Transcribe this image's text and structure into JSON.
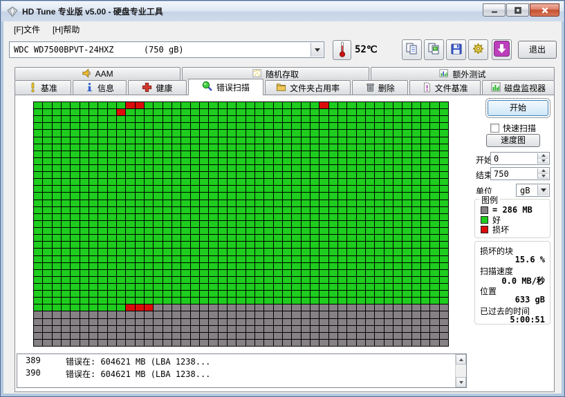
{
  "window": {
    "title": "HD Tune 专业版 v5.00 - 硬盘专业工具"
  },
  "menu": {
    "items": [
      {
        "label": "[F]文件"
      },
      {
        "label": "[H]帮助"
      }
    ]
  },
  "toolbar": {
    "drive_selector_value": "WDC WD7500BPVT-24HXZ      (750 gB)",
    "temperature": "52℃",
    "buttons": [
      {
        "icon": "copy-text-icon"
      },
      {
        "icon": "copy-image-icon"
      },
      {
        "icon": "save-icon"
      },
      {
        "icon": "options-icon"
      },
      {
        "icon": "update-icon"
      }
    ],
    "exit_label": "退出"
  },
  "tabs": {
    "row1": [
      {
        "label": "AAM",
        "icon": "speaker-icon",
        "active": false
      },
      {
        "label": "随机存取",
        "icon": "random-access-icon",
        "active": false
      },
      {
        "label": "额外测试",
        "icon": "extra-tests-icon",
        "active": false
      }
    ],
    "row2": [
      {
        "label": "基准",
        "icon": "benchmark-icon",
        "active": false
      },
      {
        "label": "信息",
        "icon": "info-icon",
        "active": false
      },
      {
        "label": "健康",
        "icon": "health-icon",
        "active": false
      },
      {
        "label": "错误扫描",
        "icon": "error-scan-icon",
        "active": true
      },
      {
        "label": "文件夹占用率",
        "icon": "folder-usage-icon",
        "active": false
      },
      {
        "label": "删除",
        "icon": "erase-icon",
        "active": false
      },
      {
        "label": "文件基准",
        "icon": "file-benchmark-icon",
        "active": false
      },
      {
        "label": "磁盘监视器",
        "icon": "disk-monitor-icon",
        "active": false
      }
    ]
  },
  "scan_controls": {
    "start_button": "开始",
    "quick_scan_label": "快速扫描",
    "quick_scan_checked": false,
    "speed_map_button": "速度图",
    "start_label": "开始",
    "start_value": "0",
    "end_label": "结束",
    "end_value": "750",
    "unit_label": "单位",
    "unit_value": "gB"
  },
  "legend": {
    "title": "图例",
    "entries": [
      {
        "swatch": "gray",
        "label": "= 286 MB"
      },
      {
        "swatch": "green",
        "label": "好"
      },
      {
        "swatch": "red",
        "label": "损坏"
      }
    ]
  },
  "stats": [
    {
      "label": "损坏的块",
      "value": "15.6 %"
    },
    {
      "label": "扫描速度",
      "value": "0.0 MB/秒"
    },
    {
      "label": "位置",
      "value": "633 gB"
    },
    {
      "label": "已过去的时间",
      "value": "5:00:51"
    }
  ],
  "errors": [
    {
      "num": "389",
      "message": "错误在: 604621 MB (LBA 1238..."
    },
    {
      "num": "390",
      "message": "错误在: 604621 MB (LBA 1238..."
    }
  ],
  "chart_data": {
    "type": "heatmap",
    "title": "disk surface error-scan block map",
    "columns": 45,
    "rows": 35,
    "block_size_label": "= 286 MB",
    "legend": {
      "G": "好 (good)",
      "B": "损坏 (damaged)",
      "U": "unscanned"
    },
    "cell_colors": {
      "G": "#1ecd1e",
      "B": "#dd0c0c",
      "U": "#858185"
    },
    "block_rows_rle": [
      "10G 2B 19G 1B 13G",
      "9G 1B 35G",
      "45G",
      "45G",
      "45G",
      "45G",
      "45G",
      "45G",
      "45G",
      "45G",
      "45G",
      "45G",
      "45G",
      "45G",
      "45G",
      "45G",
      "45G",
      "45G",
      "45G",
      "45G",
      "45G",
      "45G",
      "45G",
      "45G",
      "45G",
      "45G",
      "45G",
      "45G",
      "45G",
      "10G 3B 32U",
      "45U",
      "45U",
      "45U",
      "45U",
      "45U"
    ]
  },
  "colors": {
    "good_green": "#1ecd1e",
    "bad_red": "#dd0c0c",
    "unscanned_gray": "#858185",
    "update_purple": "#bc3fbc",
    "temp_red": "#cc1111",
    "dialog_bg": "#f0f0f0"
  }
}
